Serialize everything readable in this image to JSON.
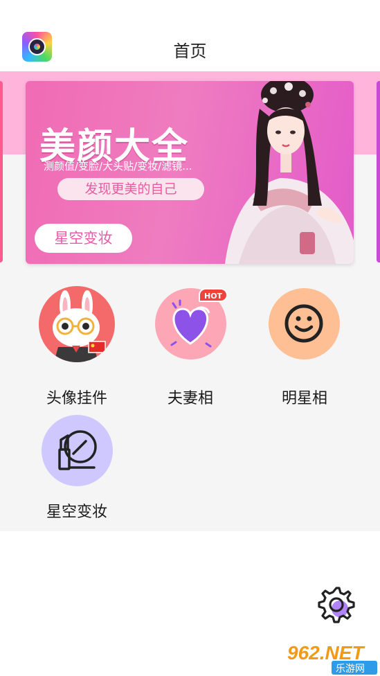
{
  "header": {
    "title": "首页",
    "logo_icon": "app-logo-icon"
  },
  "banner": {
    "title": "美颜大全",
    "subtitle": "测颜值/变脸/大头贴/变妆/滤镜...",
    "slogan": "发现更美的自己",
    "button_label": "星空变妆"
  },
  "features": [
    {
      "label": "头像挂件",
      "icon": "bunny-avatar-icon",
      "color": "#f46a6a"
    },
    {
      "label": "夫妻相",
      "icon": "heart-icon",
      "color": "#fda7b6",
      "badge": "HOT"
    },
    {
      "label": "明星相",
      "icon": "smiley-icon",
      "color": "#ffbf94"
    },
    {
      "label": "星空变妆",
      "icon": "makeup-icon",
      "color": "#cfc8ff"
    }
  ],
  "settings": {
    "icon": "gear-icon"
  },
  "watermark": {
    "top": "962.NET",
    "bottom": "乐游网"
  },
  "colors": {
    "accent_pink": "#ffb4dc",
    "hot_red": "#f0423d",
    "background": "#f5f5f5"
  }
}
